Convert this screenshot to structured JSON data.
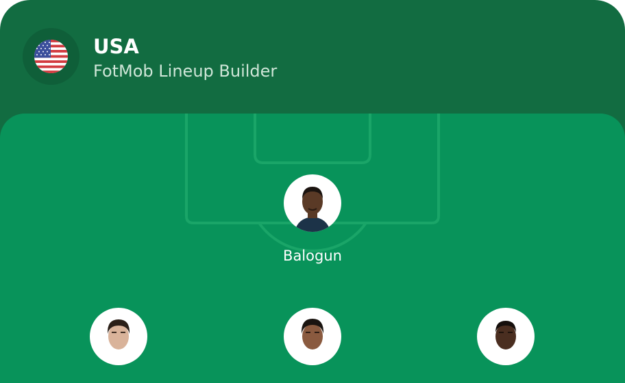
{
  "header": {
    "team_name": "USA",
    "subtitle": "FotMob Lineup Builder",
    "flag_icon": "usa-flag-icon"
  },
  "colors": {
    "header_bg": "#126c41",
    "pitch_bg": "#08935a",
    "pitch_lines": "#1aa568",
    "text_primary": "#ffffff",
    "text_secondary": "#cfe6d8"
  },
  "players": [
    {
      "name": "Balogun",
      "skin": "#5a3a26",
      "hair": "#1b1410"
    },
    {
      "name": "",
      "skin": "#d9b39a",
      "hair": "#2a1f18"
    },
    {
      "name": "",
      "skin": "#8a5a3f",
      "hair": "#1a1410"
    },
    {
      "name": "",
      "skin": "#4a2e20",
      "hair": "#150f0c"
    }
  ]
}
